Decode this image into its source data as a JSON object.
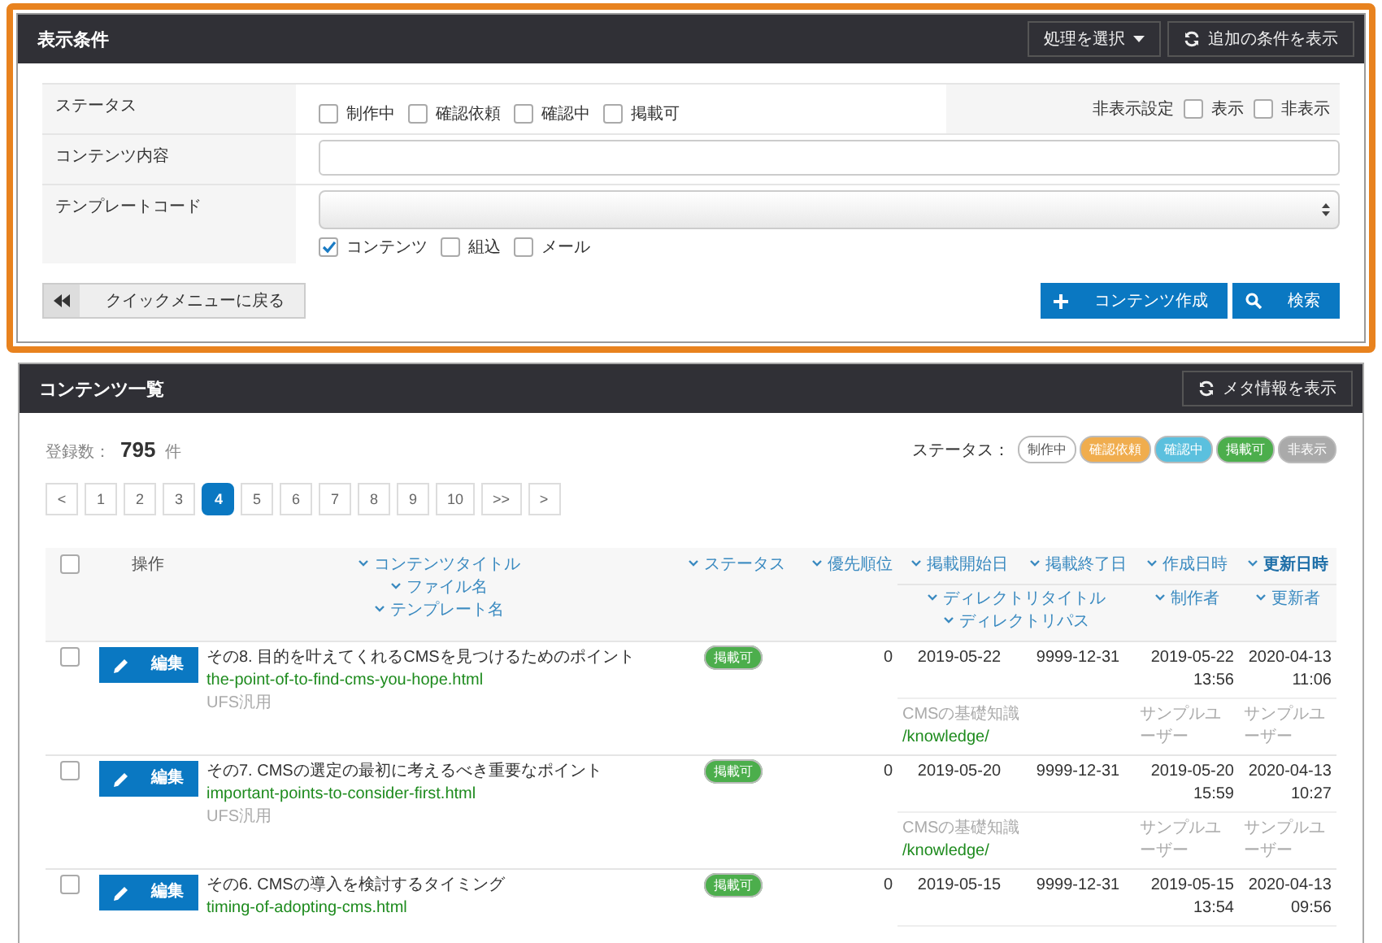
{
  "filter_panel": {
    "title": "表示条件",
    "header_buttons": [
      {
        "kind": "dropdown",
        "label": "処理を選択"
      },
      {
        "kind": "refresh",
        "label": "追加の条件を表示"
      }
    ],
    "status_row": {
      "label": "ステータス",
      "options": [
        {
          "label": "制作中",
          "checked": false
        },
        {
          "label": "確認依頼",
          "checked": false
        },
        {
          "label": "確認中",
          "checked": false
        },
        {
          "label": "掲載可",
          "checked": false
        }
      ],
      "hidden_label": "非表示設定",
      "hidden_options": [
        {
          "label": "表示",
          "checked": false
        },
        {
          "label": "非表示",
          "checked": false
        }
      ]
    },
    "content_row": {
      "label": "コンテンツ内容"
    },
    "template_row": {
      "label": "テンプレートコード",
      "types": [
        {
          "label": "コンテンツ",
          "checked": true
        },
        {
          "label": "組込",
          "checked": false
        },
        {
          "label": "メール",
          "checked": false
        }
      ]
    },
    "back_button": "クイックメニューに戻る",
    "create_button": "コンテンツ作成",
    "search_button": "検索"
  },
  "list_panel": {
    "title": "コンテンツ一覧",
    "meta_button": "メタ情報を表示",
    "count_label": "登録数：",
    "count": "795",
    "count_unit": "件",
    "legend_label": "ステータス：",
    "legend": [
      {
        "label": "制作中",
        "color": "#ffffff"
      },
      {
        "label": "確認依頼",
        "color": "#f0ad4e"
      },
      {
        "label": "確認中",
        "color": "#5bc0de"
      },
      {
        "label": "掲載可",
        "color": "#4cae4c"
      },
      {
        "label": "非表示",
        "color": "#aaaaaa"
      }
    ],
    "pages": [
      {
        "label": "<",
        "selected": false
      },
      {
        "label": "1",
        "selected": false
      },
      {
        "label": "2",
        "selected": false
      },
      {
        "label": "3",
        "selected": false
      },
      {
        "label": "4",
        "selected": true
      },
      {
        "label": "5",
        "selected": false
      },
      {
        "label": "6",
        "selected": false
      },
      {
        "label": "7",
        "selected": false
      },
      {
        "label": "8",
        "selected": false
      },
      {
        "label": "9",
        "selected": false
      },
      {
        "label": "10",
        "selected": false
      },
      {
        "label": ">>",
        "selected": false
      },
      {
        "label": ">",
        "selected": false
      }
    ],
    "table": {
      "columns": {
        "action": "操作",
        "title": [
          "コンテンツタイトル",
          "ファイル名",
          "テンプレート名"
        ],
        "status": "ステータス",
        "priority": "優先順位",
        "start": "掲載開始日",
        "end": "掲載終了日",
        "created": "作成日時",
        "updated": "更新日時",
        "directory": [
          "ディレクトリタイトル",
          "ディレクトリパス"
        ],
        "creator": "制作者",
        "updater": "更新者"
      },
      "select_all_checked": false,
      "rows": [
        {
          "checked": false,
          "edit_label": "編集",
          "title": "その8. 目的を叶えてくれるCMSを見つけるためのポイント",
          "file": "the-point-of-to-find-cms-you-hope.html",
          "template": "UFS汎用",
          "status": {
            "label": "掲載可",
            "color": "#4cae4c"
          },
          "priority": "0",
          "start": "2019-05-22",
          "end": "9999-12-31",
          "created": [
            "2019-05-22",
            "13:56"
          ],
          "updated": [
            "2020-04-13",
            "11:06"
          ],
          "dir_title": "CMSの基礎知識",
          "dir_path": "/knowledge/",
          "creator": "サンプルユーザー",
          "updater": "サンプルユーザー"
        },
        {
          "checked": false,
          "edit_label": "編集",
          "title": "その7. CMSの選定の最初に考えるべき重要なポイント",
          "file": "important-points-to-consider-first.html",
          "template": "UFS汎用",
          "status": {
            "label": "掲載可",
            "color": "#4cae4c"
          },
          "priority": "0",
          "start": "2019-05-20",
          "end": "9999-12-31",
          "created": [
            "2019-05-20",
            "15:59"
          ],
          "updated": [
            "2020-04-13",
            "10:27"
          ],
          "dir_title": "CMSの基礎知識",
          "dir_path": "/knowledge/",
          "creator": "サンプルユーザー",
          "updater": "サンプルユーザー"
        },
        {
          "checked": false,
          "edit_label": "編集",
          "title": "その6. CMSの導入を検討するタイミング",
          "file": "timing-of-adopting-cms.html",
          "status": {
            "label": "掲載可",
            "color": "#4cae4c"
          },
          "priority": "0",
          "start": "2019-05-15",
          "end": "9999-12-31",
          "created": [
            "2019-05-15",
            "13:54"
          ],
          "updated": [
            "2020-04-13",
            "09:56"
          ]
        }
      ]
    }
  }
}
